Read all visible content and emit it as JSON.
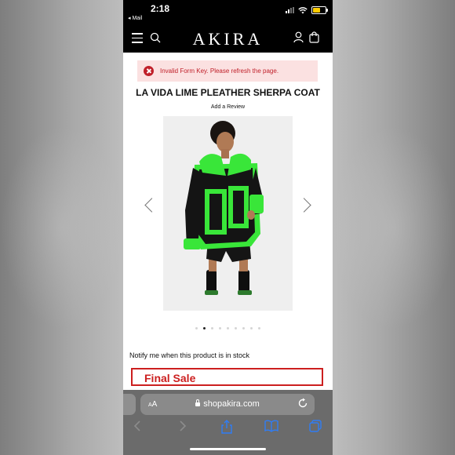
{
  "status_bar": {
    "time": "2:18",
    "back_app": "◂ Mail"
  },
  "header": {
    "logo": "AKIRA"
  },
  "error": {
    "message": "Invalid Form Key. Please refresh the page."
  },
  "product": {
    "title": "LA VIDA LIME PLEATHER SHERPA COAT",
    "review_link": "Add a Review",
    "image_alt": "Model wearing black and lime green pleather sherpa coat",
    "notify_text": "Notify me when this product is in stock",
    "final_sale": "Final Sale",
    "gallery": {
      "total": 9,
      "active_index": 1
    }
  },
  "browser": {
    "aa_small": "A",
    "aa_large": "A",
    "url": "shopakira.com"
  },
  "colors": {
    "accent_lime": "#39e639",
    "error": "#c0202a",
    "final_sale_red": "#cc1f1f"
  }
}
